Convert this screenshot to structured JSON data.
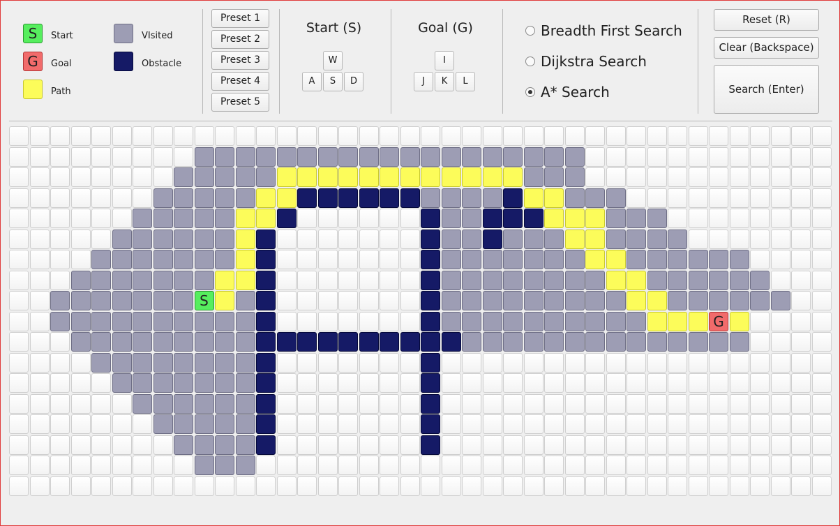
{
  "legend": {
    "start_label": "Start",
    "start_glyph": "S",
    "goal_label": "Goal",
    "goal_glyph": "G",
    "path_label": "Path",
    "visited_label": "VIsited",
    "obstacle_label": "Obstacle"
  },
  "presets": [
    "Preset 1",
    "Preset 2",
    "Preset 3",
    "Preset 4",
    "Preset 5"
  ],
  "start_controls": {
    "heading": "Start (S)",
    "keys": [
      "W",
      "A",
      "S",
      "D"
    ]
  },
  "goal_controls": {
    "heading": "Goal (G)",
    "keys": [
      "I",
      "J",
      "K",
      "L"
    ]
  },
  "algorithms": [
    {
      "label": "Breadth First Search",
      "selected": false
    },
    {
      "label": "Dijkstra Search",
      "selected": false
    },
    {
      "label": "A* Search",
      "selected": true
    }
  ],
  "actions": {
    "reset": "Reset (R)",
    "clear": "Clear (Backspace)",
    "search": "Search (Enter)"
  },
  "colors": {
    "start": "#56ee5e",
    "goal": "#f16b6b",
    "path": "#fcfc5a",
    "visited": "#9d9db4",
    "obstacle": "#151a66",
    "empty": "#fafafa"
  },
  "grid": {
    "columns": 40,
    "rows": 18,
    "start_cell": [
      9,
      8
    ],
    "goal_cell": [
      34,
      9
    ],
    "legend_of_codes": {
      ".": "empty",
      "v": "visited",
      "o": "obstacle",
      "p": "path"
    },
    "cells": [
      "........................................",
      ".........vvvvvvvvvvvvvvvvvvv............",
      "........vvvvvppppppppppppvvv............",
      ".......vvvvvppoooooovvvvoppvvv..........",
      "......vvvvvppo......ovvooopppvvv........",
      ".....vvvvvvpo.......ovvovvvppvvvv.......",
      "....vvvvvvvpo.......ovvvvvvvppvvvvvv....",
      "...vvvvvvvppo.......ovvvvvvvvppvvvvvv...",
      "..vvvvvvvvpvo.......ovvvvvvvvvppvvvvvv..",
      "..vvvvvvvvvvo.......ovvvvvvvvvvppppp....",
      "...vvvvvvvvvoooooooooovvvvvvvvvvvvvv....",
      "....vvvvvvvvo.......o...................",
      ".....vvvvvvvo.......o...................",
      "......vvvvvvo.......o...................",
      ".......vvvvvo.......o...................",
      "........vvvvo.......o...................",
      ".........vvv............................",
      "........................................"
    ]
  }
}
